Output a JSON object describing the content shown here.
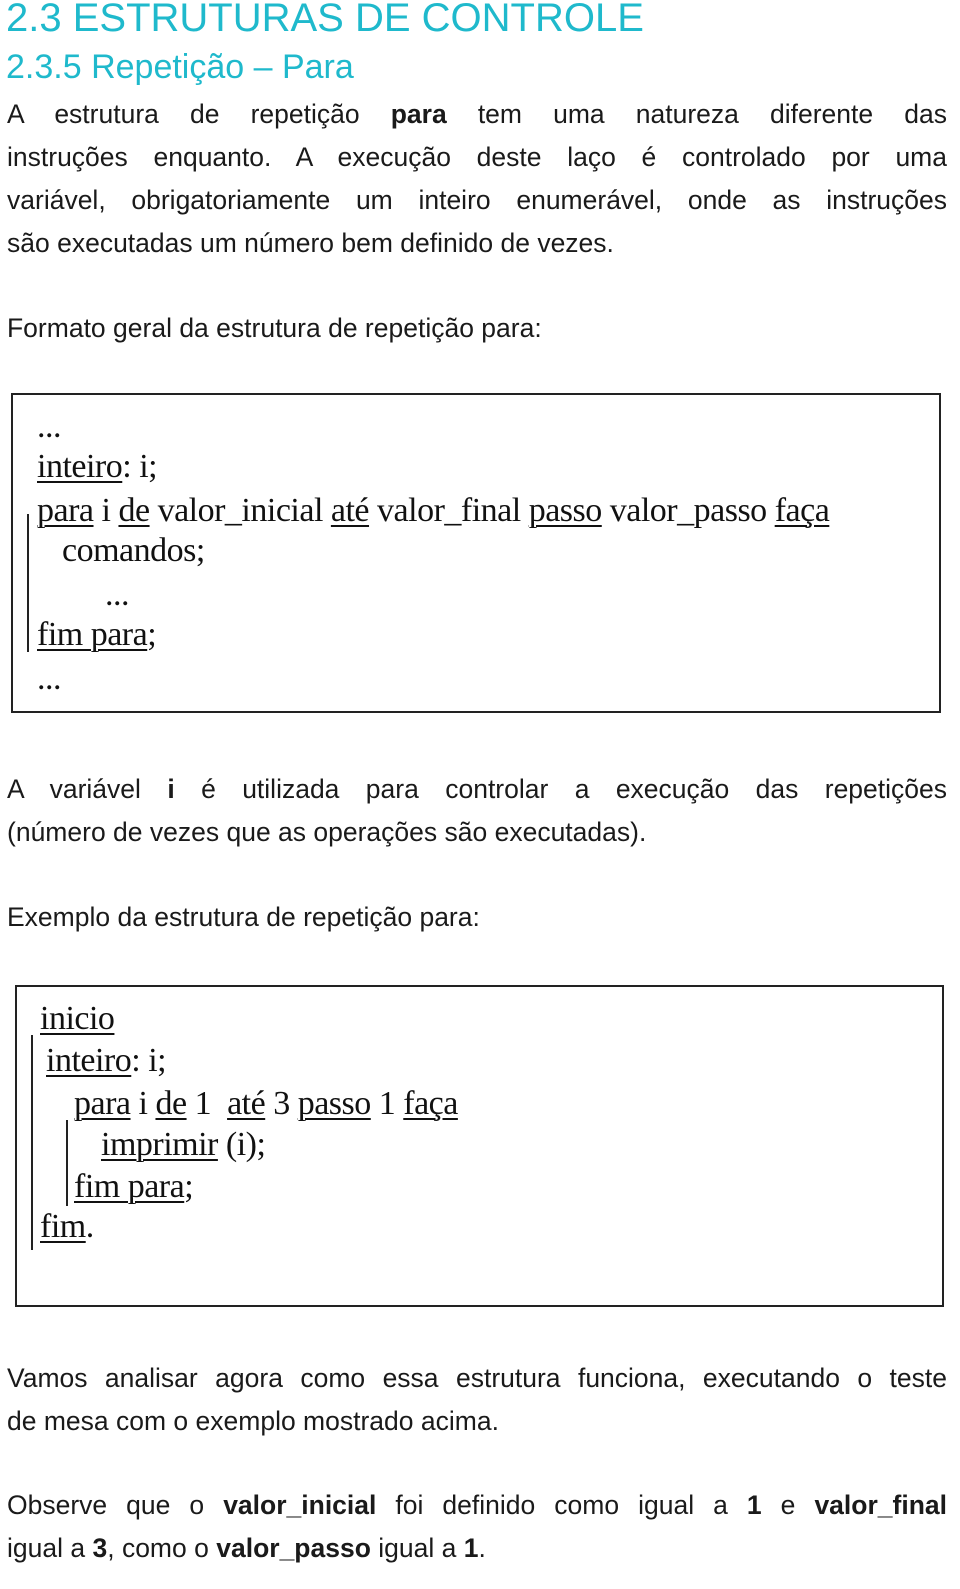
{
  "heading": {
    "title": "2.3 ESTRUTURAS DE CONTROLE",
    "subtitle": "2.3.5 Repetição – Para"
  },
  "intro": {
    "l1_a": "A estrutura de repetição",
    "l1_bold": "para",
    "l1_b": "tem uma natureza diferente das",
    "l2": "instruções enquanto. A execução deste laço é controlado por uma",
    "l3": "variável, obrigatoriamente um inteiro enumerável, onde as instruções",
    "l4": "são executadas um número bem definido de vezes."
  },
  "format_label": "Formato geral da estrutura de repetição para:",
  "format_code": {
    "dots_top": "...",
    "decl_kw": "inteiro",
    "decl_rest": ": i;",
    "loop_kw_para": "para",
    "loop_i": " i ",
    "loop_kw_de": "de",
    "loop_init": " valor_inicial ",
    "loop_kw_ate": "até",
    "loop_final": " valor_final ",
    "loop_kw_passo": "passo",
    "loop_step": " valor_passo ",
    "loop_kw_faca": "faça",
    "body": "comandos;",
    "dots_mid": "...",
    "end_kw": "fim para",
    "end_rest": ";",
    "dots_bottom": "..."
  },
  "variable_text": {
    "a": "A variável",
    "bold": "i",
    "b": "é utilizada para controlar a execução das repetições",
    "l2": "(número de vezes que as operações são executadas)."
  },
  "example_label": "Exemplo da estrutura de repetição para:",
  "example_code": {
    "start_kw": "inicio",
    "decl_kw": "inteiro",
    "decl_rest": ": i;",
    "loop_kw_para": "para",
    "loop_i": " i ",
    "loop_kw_de": "de",
    "loop_init": " 1  ",
    "loop_kw_ate": "até",
    "loop_final": " 3 ",
    "loop_kw_passo": "passo",
    "loop_step": " 1 ",
    "loop_kw_faca": "faça",
    "body_kw": "imprimir",
    "body_rest": " (i);",
    "end_loop_kw": "fim para",
    "end_loop_rest": ";",
    "end_kw": "fim",
    "end_rest": "."
  },
  "analysis_text": {
    "l1": "Vamos analisar agora como essa estrutura funciona, executando o teste",
    "l2": "de mesa com o exemplo mostrado acima."
  },
  "observe_text": {
    "a": "Observe que o",
    "b1": "valor_inicial",
    "c": "foi definido como igual a",
    "b2": "1",
    "d": "e",
    "b3": "valor_final",
    "e": "igual a",
    "b4": "3",
    "f": ", como o",
    "b5": "valor_passo",
    "g": "igual a",
    "b6": "1",
    "h": "."
  }
}
